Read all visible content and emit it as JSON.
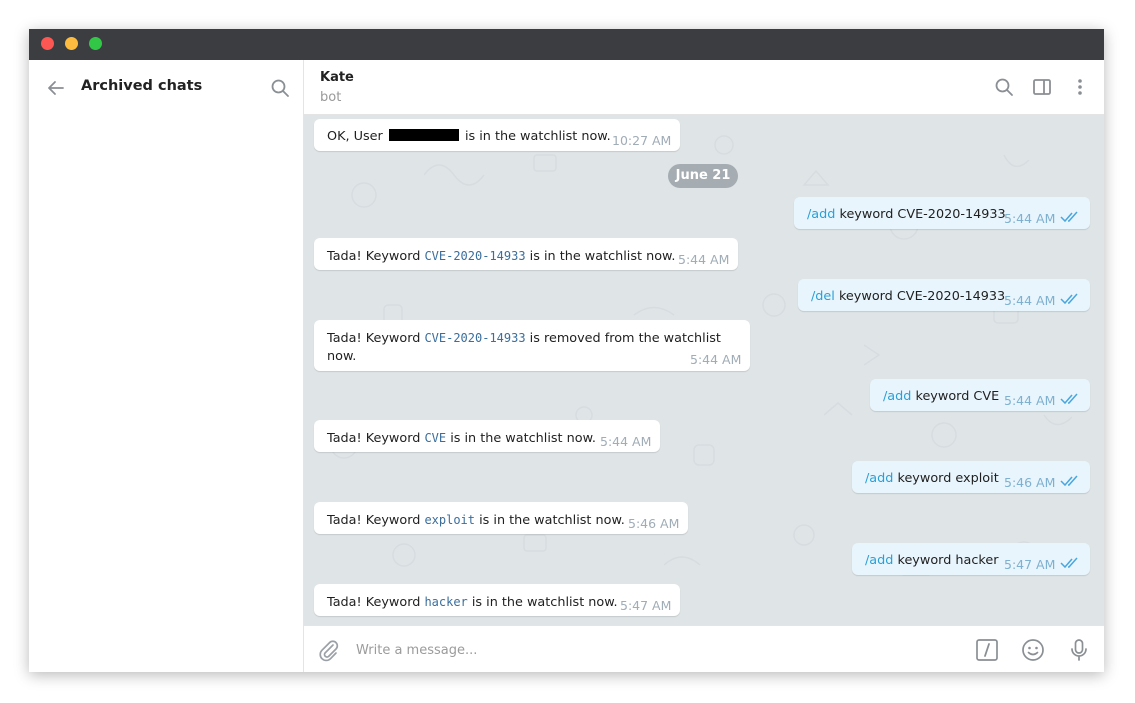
{
  "left": {
    "title": "Archived chats"
  },
  "chat": {
    "name": "Kate",
    "status": "bot"
  },
  "date_separator": "June 21",
  "messages": [
    {
      "dir": "in",
      "pre": "OK, User",
      "post": "is in the watchlist now.",
      "time": "10:27 AM"
    },
    {
      "dir": "out",
      "cmd": "/add",
      "rest": "keyword CVE-2020-14933",
      "time": "5:44 AM"
    },
    {
      "dir": "in",
      "pre": "Tada! Keyword",
      "code": "CVE-2020-14933",
      "post": "is in the watchlist now.",
      "time": "5:44 AM"
    },
    {
      "dir": "out",
      "cmd": "/del",
      "rest": "keyword CVE-2020-14933",
      "time": "5:44 AM"
    },
    {
      "dir": "in",
      "pre": "Tada! Keyword",
      "code": "CVE-2020-14933",
      "post": "is removed from the watchlist",
      "post2": "now.",
      "time": "5:44 AM"
    },
    {
      "dir": "out",
      "cmd": "/add",
      "rest": "keyword CVE",
      "time": "5:44 AM"
    },
    {
      "dir": "in",
      "pre": "Tada! Keyword",
      "code": "CVE",
      "post": "is in the watchlist now.",
      "time": "5:44 AM"
    },
    {
      "dir": "out",
      "cmd": "/add",
      "rest": "keyword exploit",
      "time": "5:46 AM"
    },
    {
      "dir": "in",
      "pre": "Tada! Keyword",
      "code": "exploit",
      "post": "is in the watchlist now.",
      "time": "5:46 AM"
    },
    {
      "dir": "out",
      "cmd": "/add",
      "rest": "keyword hacker",
      "time": "5:47 AM"
    },
    {
      "dir": "in",
      "pre": "Tada! Keyword",
      "code": "hacker",
      "post": "is in the watchlist now.",
      "time": "5:47 AM"
    }
  ],
  "composer": {
    "placeholder": "Write a message..."
  },
  "icons": {
    "back": "arrow-left-icon",
    "search": "search-icon",
    "sidebar": "sidebar-toggle-icon",
    "more": "more-vertical-icon",
    "attach": "paperclip-icon",
    "commands": "slash-commands-icon",
    "emoji": "emoji-icon",
    "mic": "microphone-icon",
    "read": "double-check-icon"
  },
  "colors": {
    "link": "#2a9fd6",
    "outgoing_bubble": "#e8f5fd",
    "incoming_bubble": "#ffffff",
    "chat_background": "#dfe4e7",
    "date_pill": "#a5acb2"
  }
}
